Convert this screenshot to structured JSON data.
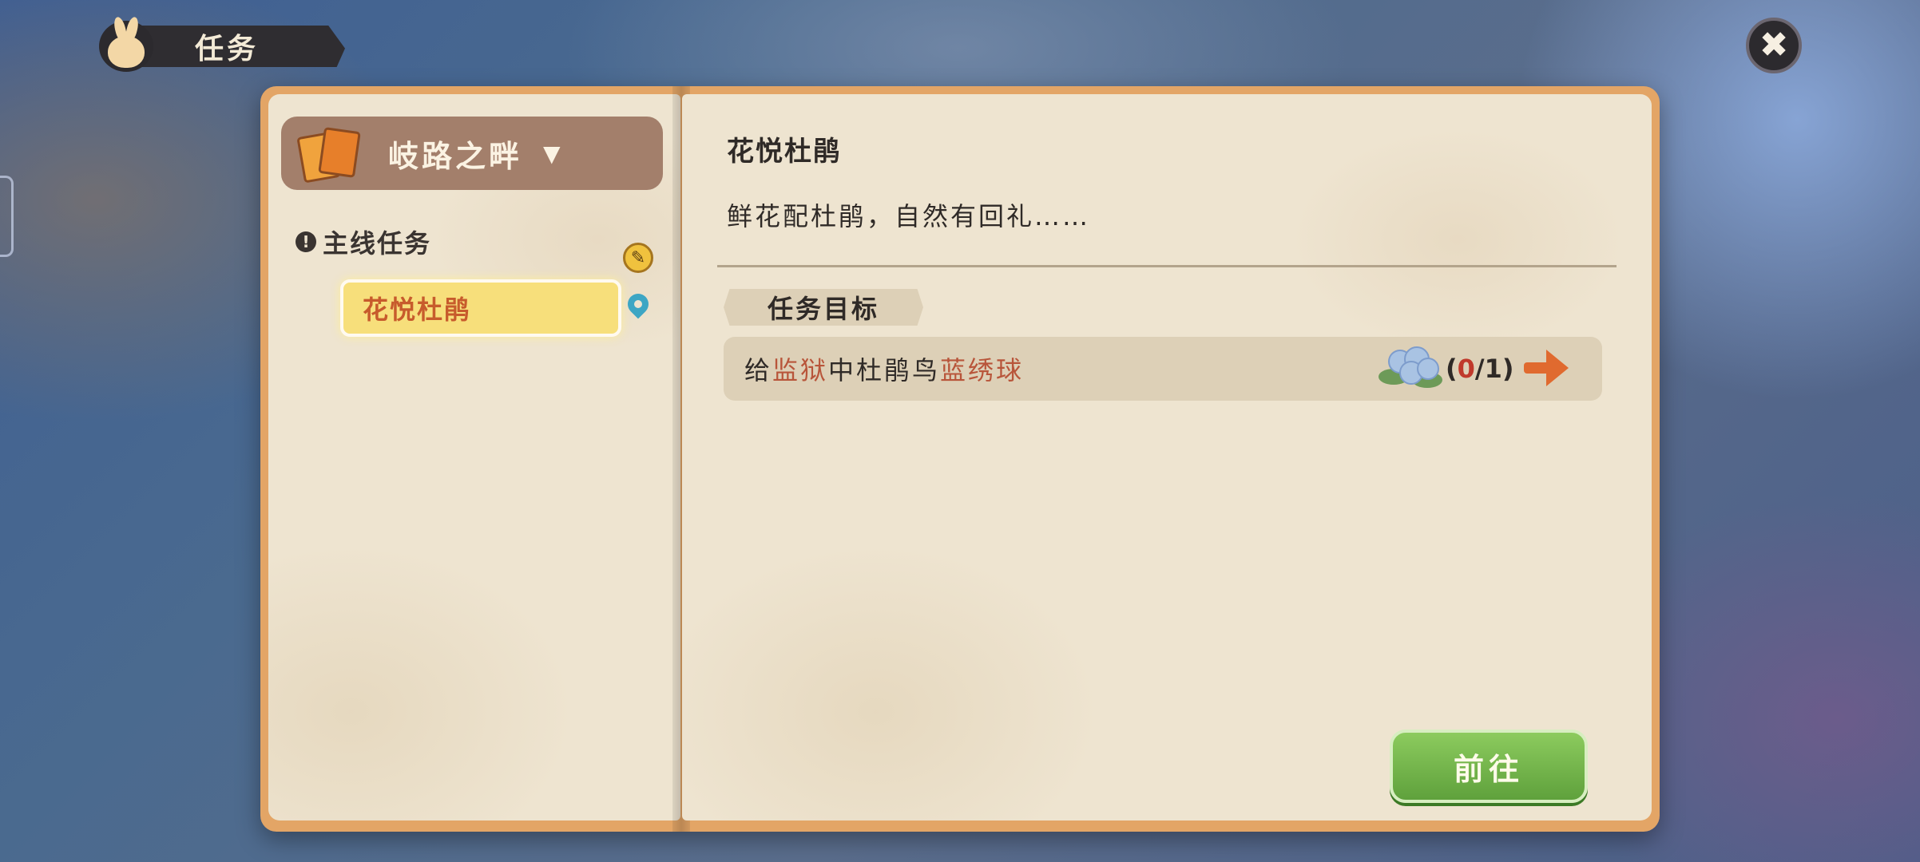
{
  "window": {
    "title": "任务"
  },
  "chapter": {
    "name": "岐路之畔",
    "caret": "▼"
  },
  "quest_list": {
    "section_label": "主线任务",
    "section_icon": "!",
    "items": [
      {
        "label": "花悦杜鹃",
        "selected": true
      }
    ]
  },
  "quest_detail": {
    "title": "花悦杜鹃",
    "description": "鲜花配杜鹃，自然有回礼……",
    "objectives_label": "任务目标",
    "objectives": [
      {
        "text_parts": [
          "给",
          "监狱",
          "中杜鹃鸟",
          "蓝绣球"
        ],
        "progress_open": "(",
        "progress_current": "0",
        "progress_rest": "/1)",
        "item_icon": "hydrangea-icon"
      }
    ]
  },
  "buttons": {
    "go_label": "前往",
    "close_icon": "✖"
  },
  "colors": {
    "accent_green": "#5fa13c",
    "highlight_text": "#b8553a",
    "quest_selected_bg": "#f7df7b",
    "book_border": "#e3a566"
  }
}
